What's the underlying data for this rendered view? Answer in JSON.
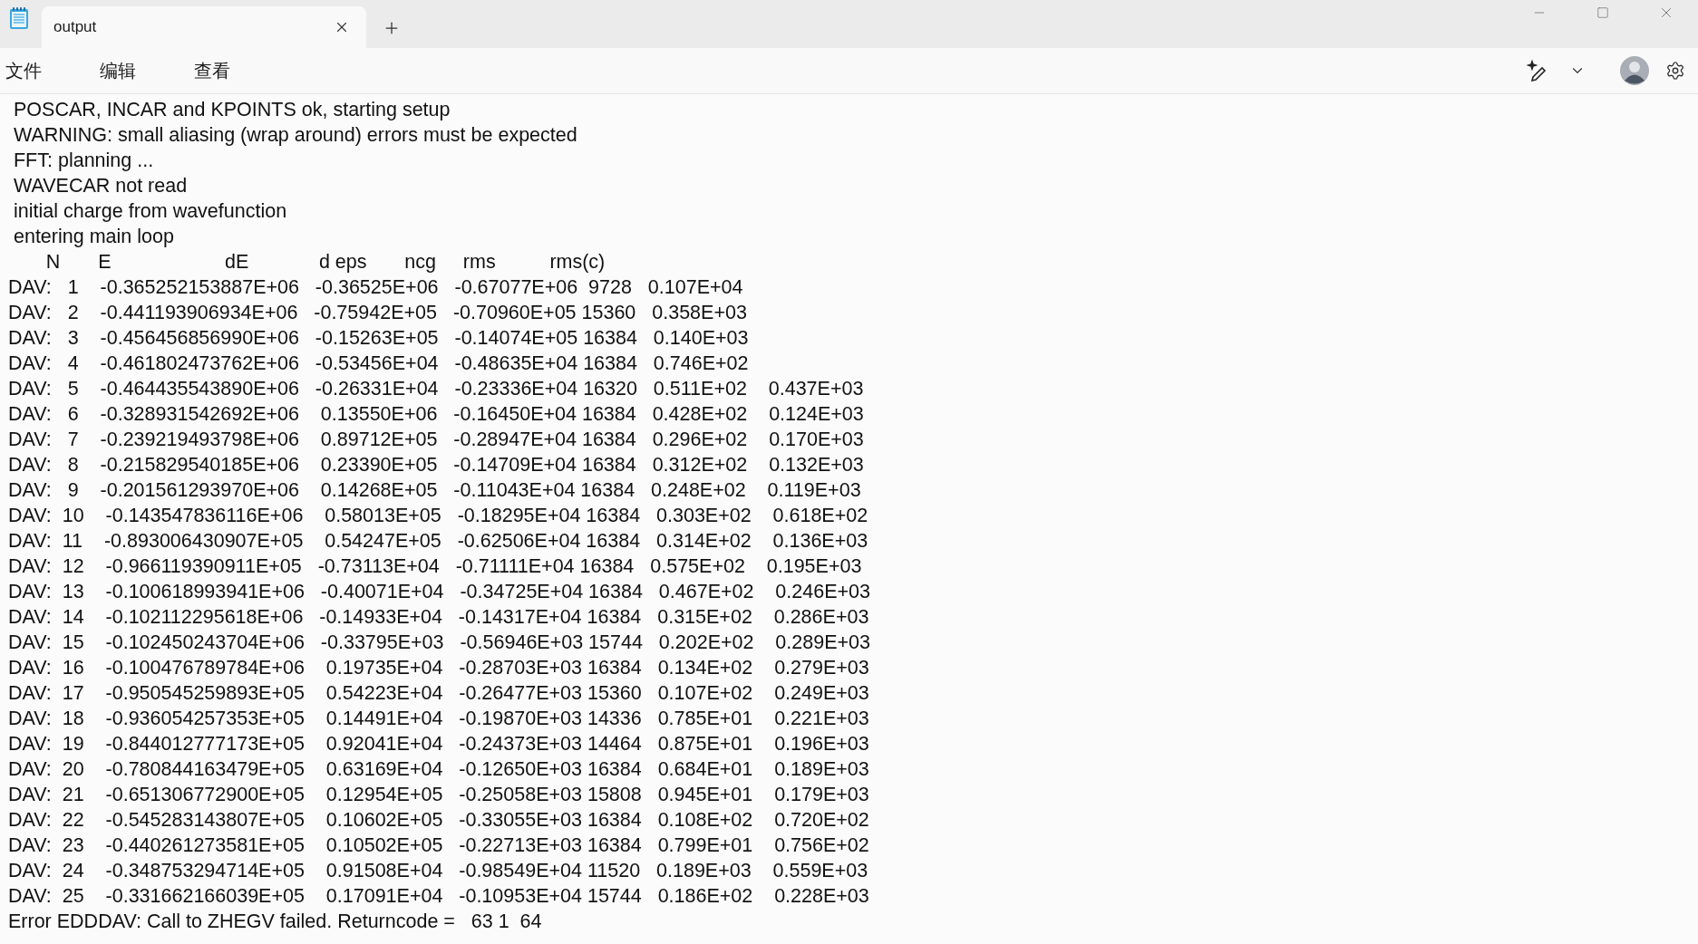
{
  "window": {
    "tab": {
      "title": "output",
      "selected": true
    }
  },
  "menu": [
    "文件",
    "编辑",
    "查看"
  ],
  "lines": [
    " POSCAR, INCAR and KPOINTS ok, starting setup",
    " WARNING: small aliasing (wrap around) errors must be expected",
    " FFT: planning ...",
    " WAVECAR not read",
    " initial charge from wavefunction",
    " entering main loop",
    "       N       E                     dE             d eps       ncg     rms          rms(c)",
    "DAV:   1    -0.365252153887E+06   -0.36525E+06   -0.67077E+06  9728   0.107E+04",
    "DAV:   2    -0.441193906934E+06   -0.75942E+05   -0.70960E+05 15360   0.358E+03",
    "DAV:   3    -0.456456856990E+06   -0.15263E+05   -0.14074E+05 16384   0.140E+03",
    "DAV:   4    -0.461802473762E+06   -0.53456E+04   -0.48635E+04 16384   0.746E+02",
    "DAV:   5    -0.464435543890E+06   -0.26331E+04   -0.23336E+04 16320   0.511E+02    0.437E+03",
    "DAV:   6    -0.328931542692E+06    0.13550E+06   -0.16450E+04 16384   0.428E+02    0.124E+03",
    "DAV:   7    -0.239219493798E+06    0.89712E+05   -0.28947E+04 16384   0.296E+02    0.170E+03",
    "DAV:   8    -0.215829540185E+06    0.23390E+05   -0.14709E+04 16384   0.312E+02    0.132E+03",
    "DAV:   9    -0.201561293970E+06    0.14268E+05   -0.11043E+04 16384   0.248E+02    0.119E+03",
    "DAV:  10    -0.143547836116E+06    0.58013E+05   -0.18295E+04 16384   0.303E+02    0.618E+02",
    "DAV:  11    -0.893006430907E+05    0.54247E+05   -0.62506E+04 16384   0.314E+02    0.136E+03",
    "DAV:  12    -0.966119390911E+05   -0.73113E+04   -0.71111E+04 16384   0.575E+02    0.195E+03",
    "DAV:  13    -0.100618993941E+06   -0.40071E+04   -0.34725E+04 16384   0.467E+02    0.246E+03",
    "DAV:  14    -0.102112295618E+06   -0.14933E+04   -0.14317E+04 16384   0.315E+02    0.286E+03",
    "DAV:  15    -0.102450243704E+06   -0.33795E+03   -0.56946E+03 15744   0.202E+02    0.289E+03",
    "DAV:  16    -0.100476789784E+06    0.19735E+04   -0.28703E+03 16384   0.134E+02    0.279E+03",
    "DAV:  17    -0.950545259893E+05    0.54223E+04   -0.26477E+03 15360   0.107E+02    0.249E+03",
    "DAV:  18    -0.936054257353E+05    0.14491E+04   -0.19870E+03 14336   0.785E+01    0.221E+03",
    "DAV:  19    -0.844012777173E+05    0.92041E+04   -0.24373E+03 14464   0.875E+01    0.196E+03",
    "DAV:  20    -0.780844163479E+05    0.63169E+04   -0.12650E+03 16384   0.684E+01    0.189E+03",
    "DAV:  21    -0.651306772900E+05    0.12954E+05   -0.25058E+03 15808   0.945E+01    0.179E+03",
    "DAV:  22    -0.545283143807E+05    0.10602E+05   -0.33055E+03 16384   0.108E+02    0.720E+02",
    "DAV:  23    -0.440261273581E+05    0.10502E+05   -0.22713E+03 16384   0.799E+01    0.756E+02",
    "DAV:  24    -0.348753294714E+05    0.91508E+04   -0.98549E+04 11520   0.189E+03    0.559E+03",
    "DAV:  25    -0.331662166039E+05    0.17091E+04   -0.10953E+04 15744   0.186E+02    0.228E+03",
    "Error EDDDAV: Call to ZHEGV failed. Returncode =   63 1  64"
  ]
}
